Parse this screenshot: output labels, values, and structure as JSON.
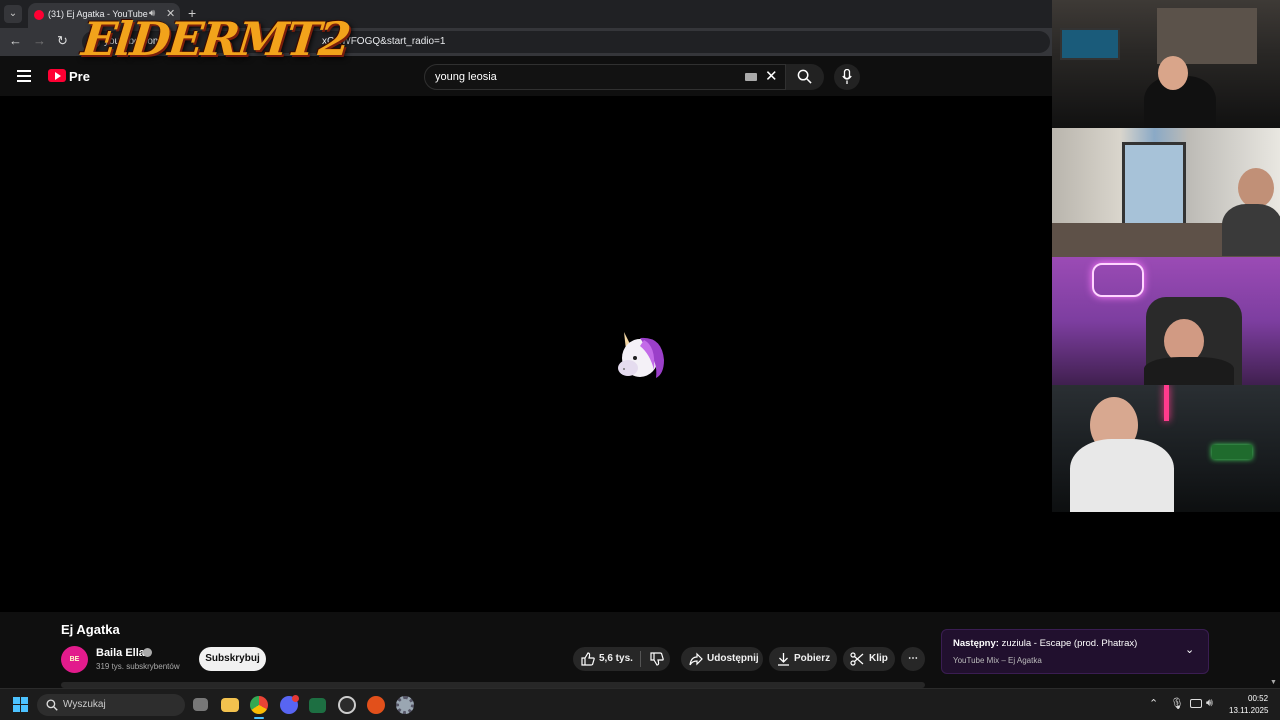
{
  "browser": {
    "tab_title": "(31) Ej Agatka - YouTube",
    "url_visible": "youtube.com",
    "url_tail": "xCRWFOGQ&start_radio=1"
  },
  "youtube": {
    "logo_text": "Pre",
    "search_value": "young leosia",
    "video_title": "Ej Agatka",
    "channel_name": "Baila Ella",
    "channel_avatar_text": "BE",
    "subscribers": "319 tys. subskrybentów",
    "subscribe_label": "Subskrybuj",
    "likes": "5,6 tys.",
    "share_label": "Udostępnij",
    "download_label": "Pobierz",
    "clip_label": "Klip",
    "more_label": "⋯",
    "next": {
      "prefix": "Następny:",
      "title": "zuziula - Escape (prod. Phatrax)",
      "subtitle": "YouTube Mix – Ej Agatka"
    }
  },
  "overlay": {
    "stream_logo": "ElDERMT2"
  },
  "taskbar": {
    "search_placeholder": "Wyszukaj",
    "time": "00:52",
    "date": "13.11.2025",
    "apps": [
      "file-explorer",
      "chrome",
      "discord",
      "excel",
      "obs",
      "ea",
      "settings"
    ]
  },
  "colors": {
    "yt_red": "#ff0033",
    "accent_blue": "#4cc2ff",
    "next_card_bg": "#21102e"
  }
}
